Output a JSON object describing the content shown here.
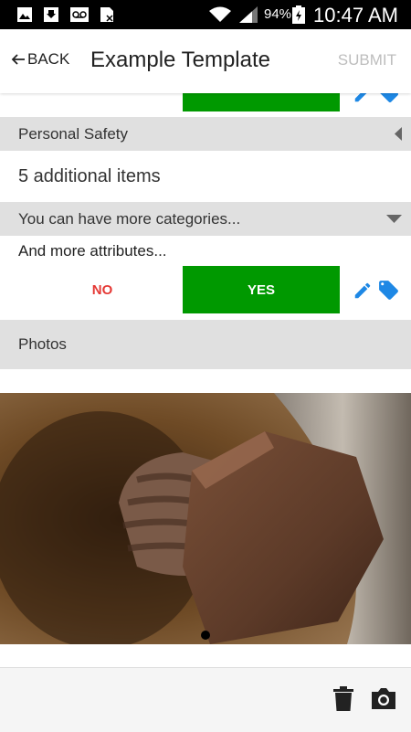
{
  "status_bar": {
    "battery_percent": "94%",
    "time": "10:47 AM",
    "icons": [
      "image-icon",
      "download-icon",
      "voicemail-icon",
      "sim-icon",
      "wifi-icon",
      "signal-icon",
      "battery-icon"
    ]
  },
  "app_bar": {
    "back_label": "BACK",
    "title": "Example Template",
    "submit_label": "SUBMIT"
  },
  "form": {
    "personal_safety": {
      "label": "Personal Safety",
      "collapsed_summary": "5 additional items"
    },
    "more_categories": {
      "label": "You can have more categories..."
    },
    "attribute": {
      "label": "And more attributes...",
      "no_label": "NO",
      "yes_label": "YES",
      "selected": "YES"
    },
    "photos": {
      "label": "Photos",
      "page_count": 1,
      "current_page": 1
    }
  },
  "colors": {
    "yes_green": "#009900",
    "no_red": "#e53935",
    "icon_blue": "#1e88e5",
    "category_gray": "#e0e0e0",
    "submit_disabled": "#bdbdbd"
  },
  "bottom_bar": {
    "icons": [
      "delete-icon",
      "camera-icon"
    ]
  }
}
